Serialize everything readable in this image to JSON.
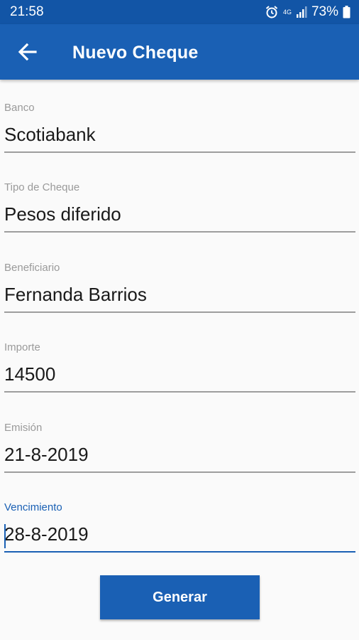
{
  "status_bar": {
    "time": "21:58",
    "network": "4G",
    "battery_percent": "73%",
    "icons": [
      "alarm-icon",
      "signal-icon",
      "battery-icon"
    ]
  },
  "app_bar": {
    "title": "Nuevo Cheque",
    "back_icon": "arrow-left-icon",
    "color": "#1a60b4"
  },
  "form": {
    "banco": {
      "label": "Banco",
      "value": "Scotiabank"
    },
    "tipo": {
      "label": "Tipo de Cheque",
      "value": "Pesos diferido"
    },
    "beneficiario": {
      "label": "Beneficiario",
      "value": "Fernanda Barrios"
    },
    "importe": {
      "label": "Importe",
      "value": "14500"
    },
    "emision": {
      "label": "Emisión",
      "value": "21-8-2019"
    },
    "vencimiento": {
      "label": "Vencimiento",
      "value": "28-8-2019"
    }
  },
  "actions": {
    "generar_label": "Generar"
  }
}
